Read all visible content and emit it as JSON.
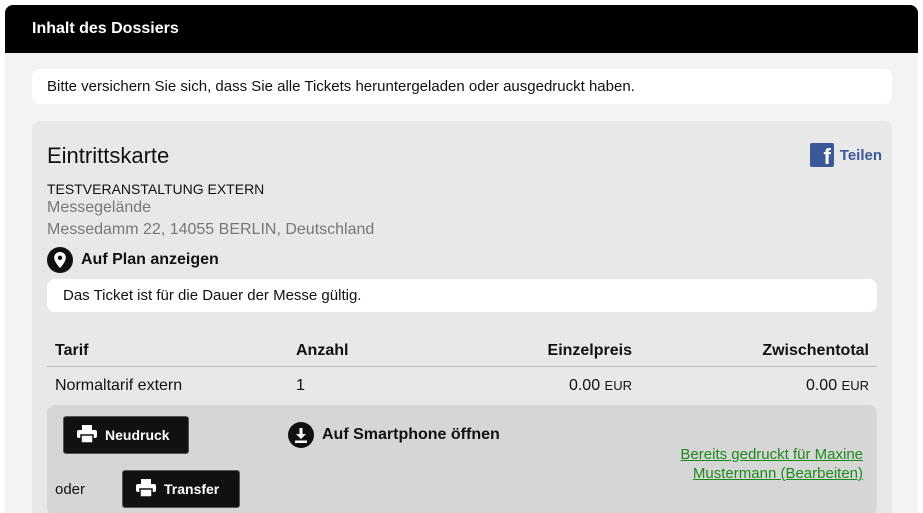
{
  "header": {
    "title": "Inhalt des Dossiers"
  },
  "notice": {
    "text": "Bitte versichern Sie sich, dass Sie alle Tickets heruntergeladen oder ausgedruckt haben."
  },
  "ticket": {
    "title": "Eintrittskarte",
    "share_label": "Teilen",
    "event_name": "TESTVERANSTALTUNG EXTERN",
    "venue": "Messegelände",
    "address": "Messedamm 22, 14055 BERLIN, Deutschland",
    "map_link": "Auf Plan anzeigen",
    "validity": "Das Ticket ist für die Dauer der Messe gültig."
  },
  "table": {
    "headers": [
      "Tarif",
      "Anzahl",
      "Einzelpreis",
      "Zwischentotal"
    ],
    "rows": [
      {
        "tarif": "Normaltarif extern",
        "anzahl": "1",
        "einzelpreis": "0.00",
        "zwischentotal": "0.00",
        "currency": "EUR"
      }
    ]
  },
  "actions": {
    "reprint_label": "Neudruck",
    "smartphone_label": "Auf Smartphone öffnen",
    "or_label": "oder",
    "transfer_label": "Transfer",
    "printed_link_line1": "Bereits gedruckt für Maxine",
    "printed_link_line2": "Mustermann (Bearbeiten)"
  },
  "colors": {
    "header_bg": "#000000",
    "facebook": "#3b5998",
    "link_green": "#1e8a1e"
  }
}
